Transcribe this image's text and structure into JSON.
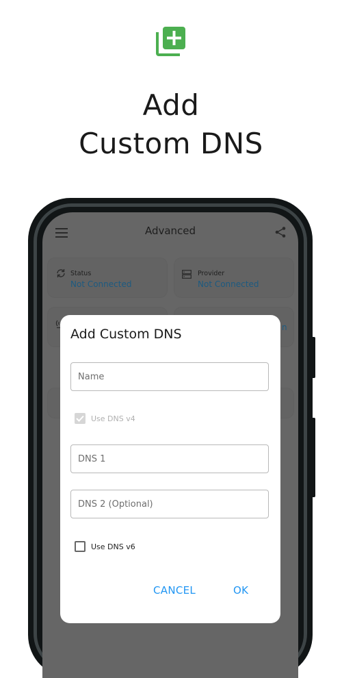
{
  "hero": {
    "icon": "add-to-library-icon",
    "title_line1": "Add",
    "title_line2": "Custom DNS",
    "accent_color": "#4caf50"
  },
  "app": {
    "title": "Advanced",
    "menu_icon": "hamburger-menu-icon",
    "share_icon": "share-icon"
  },
  "cards": [
    {
      "icon": "sync-icon",
      "label": "Status",
      "value": "Not Connected"
    },
    {
      "icon": "server-icon",
      "label": "Provider",
      "value": "Not Connected"
    },
    {
      "icon": "wifi-signal-icon",
      "label": "",
      "value": ""
    },
    {
      "icon": "",
      "label": "",
      "value": "n"
    }
  ],
  "dialog": {
    "title": "Add Custom DNS",
    "name_placeholder": "Name",
    "use_v4_label": "Use DNS v4",
    "use_v4_checked": true,
    "use_v4_disabled": true,
    "dns1_placeholder": "DNS 1",
    "dns2_placeholder": "DNS 2 (Optional)",
    "use_v6_label": "Use DNS v6",
    "use_v6_checked": false,
    "cancel_label": "CANCEL",
    "ok_label": "OK",
    "button_color": "#2196f3"
  }
}
